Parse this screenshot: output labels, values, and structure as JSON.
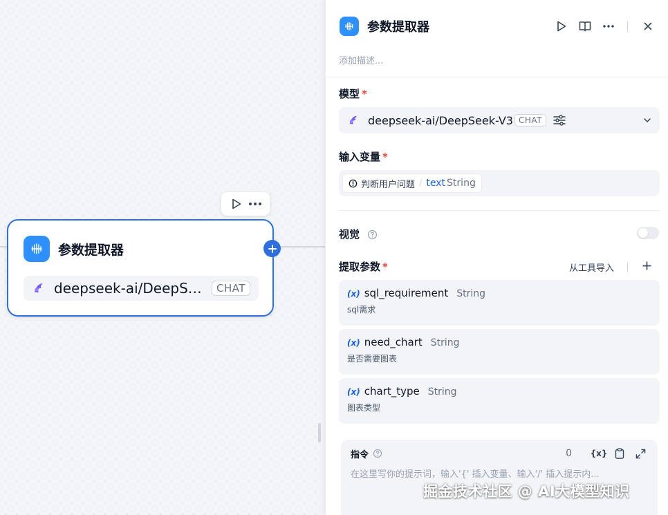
{
  "canvas": {
    "node": {
      "title": "参数提取器",
      "model_name": "deepseek-ai/DeepSeek-V3",
      "model_badge": "CHAT"
    },
    "node_toolbar": {
      "run_icon": "play-icon",
      "more_icon": "more-icon"
    }
  },
  "panel": {
    "title": "参数提取器",
    "description_placeholder": "添加描述...",
    "actions": [
      "play-icon",
      "book-icon",
      "more-icon",
      "close-icon"
    ],
    "model": {
      "label": "模型",
      "required": "*",
      "value": "deepseek-ai/DeepSeek-V3",
      "badge": "CHAT"
    },
    "input_var": {
      "label": "输入变量",
      "required": "*",
      "source_node": "判断用户问题",
      "separator": "/",
      "var_name": "text",
      "var_type": "String"
    },
    "vision": {
      "label": "视觉",
      "enabled": false
    },
    "params": {
      "label": "提取参数",
      "required": "*",
      "import_label": "从工具导入",
      "items": [
        {
          "icon": "(x)",
          "name": "sql_requirement",
          "type": "String",
          "desc": "sql需求"
        },
        {
          "icon": "(x)",
          "name": "need_chart",
          "type": "String",
          "desc": "是否需要图表"
        },
        {
          "icon": "(x)",
          "name": "chart_type",
          "type": "String",
          "desc": "图表类型"
        }
      ]
    },
    "instruction": {
      "label": "指令",
      "count": "0",
      "var_tool": "{x}",
      "placeholder": "在这里写你的提示词，输入'{' 插入变量、输入'/' 插入提示内..."
    }
  },
  "watermark": "掘金技术社区 @ AI大模型知识",
  "colors": {
    "accent": "#2d6fe0",
    "icon_bg": "#2e90fa",
    "required": "#f04438"
  }
}
